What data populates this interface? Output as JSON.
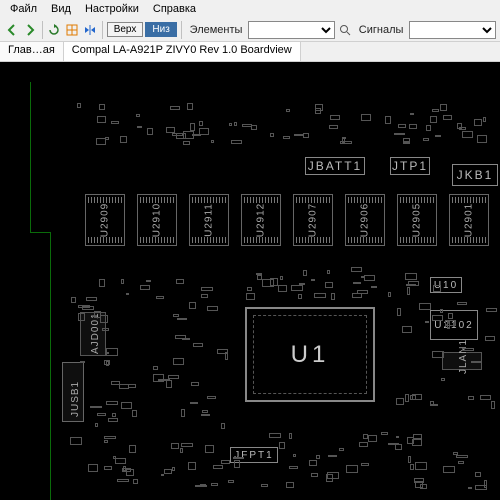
{
  "menu": {
    "file": "Файл",
    "view": "Вид",
    "settings": "Настройки",
    "help": "Справка"
  },
  "toolbar": {
    "top_label": "Верх",
    "bot_label": "Низ",
    "elements_label": "Элементы",
    "signals_label": "Сигналы",
    "elements_value": "",
    "signals_value": ""
  },
  "tabs": {
    "home": "Глав…ая",
    "doc": "Compal LA-A921P ZIVY0 Rev 1.0 Boardview"
  },
  "refs": {
    "U1": "U1",
    "JBATT1": "JBATT1",
    "JTP1": "JTP1",
    "JKB1": "JKB1",
    "JUSB1": "JUSB1",
    "JFPT1": "JFPT1",
    "JLAN1": "JLAN1",
    "AJD001": "AJD001",
    "U10": "U10",
    "U2102": "U2102",
    "slots": [
      "U2909",
      "U2910",
      "U2911",
      "U2912",
      "U2907",
      "U2906",
      "U2905",
      "U2901"
    ]
  }
}
